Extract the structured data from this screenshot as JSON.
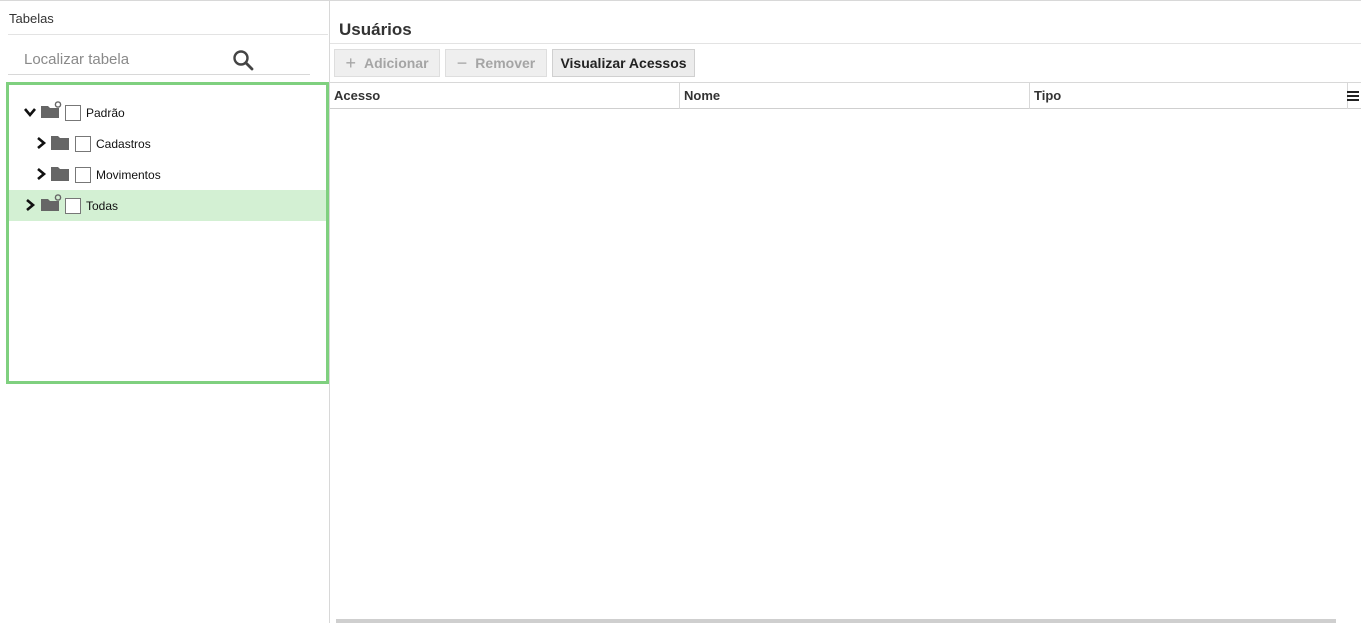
{
  "left_panel": {
    "title": "Tabelas",
    "search_placeholder": "Localizar tabela",
    "tree": [
      {
        "label": "Padrão",
        "expanded": true,
        "icon": "folder-settings-icon",
        "checked": false
      },
      {
        "label": "Cadastros",
        "expanded": false,
        "icon": "folder-icon",
        "checked": false
      },
      {
        "label": "Movimentos",
        "expanded": false,
        "icon": "folder-icon",
        "checked": false
      },
      {
        "label": "Todas",
        "expanded": false,
        "icon": "folder-settings-icon",
        "checked": false,
        "selected": true
      }
    ],
    "highlight_color": "#7fd07f",
    "selected_color": "#d3f0d3"
  },
  "right_panel": {
    "title": "Usuários",
    "toolbar": {
      "add_label": "Adicionar",
      "remove_label": "Remover",
      "view_access_label": "Visualizar Acessos"
    },
    "columns": [
      "Acesso",
      "Nome",
      "Tipo"
    ],
    "rows": []
  }
}
